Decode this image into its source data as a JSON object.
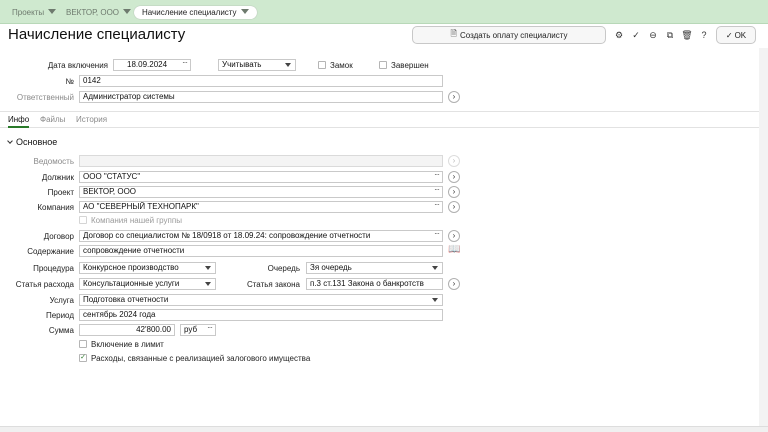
{
  "breadcrumbs": [
    {
      "label": "Проекты"
    },
    {
      "label": "ВЕКТОР, ООО"
    },
    {
      "label": "Начисление специалисту"
    }
  ],
  "page_title": "Начисление специалисту",
  "toolbar": {
    "create_payment": "Создать оплату специалисту",
    "ok": "OK",
    "icons": [
      "settings-icon",
      "check-circle-icon",
      "minus-circle-icon",
      "copy-icon",
      "trash-icon",
      "help-icon"
    ]
  },
  "header": {
    "date_label": "Дата включения",
    "date_value": "18.09.2024",
    "mode_value": "Учитывать",
    "lock_label": "Замок",
    "done_label": "Завершен",
    "number_label": "№",
    "number_value": "0142",
    "responsible_label": "Ответственный",
    "responsible_value": "Администратор системы"
  },
  "tabs": [
    {
      "label": "Инфо"
    },
    {
      "label": "Файлы"
    },
    {
      "label": "История"
    }
  ],
  "section": {
    "title": "Основное"
  },
  "form": {
    "statement_label": "Ведомость",
    "statement_value": "",
    "debtor_label": "Должник",
    "debtor_value": "ООО \"СТАТУС\"",
    "project_label": "Проект",
    "project_value": "ВЕКТОР, ООО",
    "company_label": "Компания",
    "company_value": "АО \"СЕВЕРНЫЙ ТЕХНОПАРК\"",
    "our_company_label": "Компания нашей группы",
    "contract_label": "Договор",
    "contract_value": "Договор со специалистом № 18/0918 от 18.09.24: сопровождение отчетности",
    "content_label": "Содержание",
    "content_value": "сопровождение отчетности",
    "procedure_label": "Процедура",
    "procedure_value": "Конкурсное производство",
    "queue_label": "Очередь",
    "queue_value": "Зя очередь",
    "expense_label": "Статья расхода",
    "expense_value": "Консультационные услуги",
    "law_label": "Статья закона",
    "law_value": "п.3 ст.131 Закона о банкротств",
    "service_label": "Услуга",
    "service_value": "Подготовка отчетности",
    "period_label": "Период",
    "period_value": "сентябрь 2024 года",
    "sum_label": "Сумма",
    "sum_value": "42'800.00",
    "currency_value": "руб",
    "limit_label": "Включение в лимит",
    "limit_checked": false,
    "collateral_label": "Расходы, связанные с реализацией залогового имущества",
    "collateral_checked": true
  },
  "colors": {
    "tabbar": "#cfe9cf",
    "accent": "#2a7a2a"
  }
}
